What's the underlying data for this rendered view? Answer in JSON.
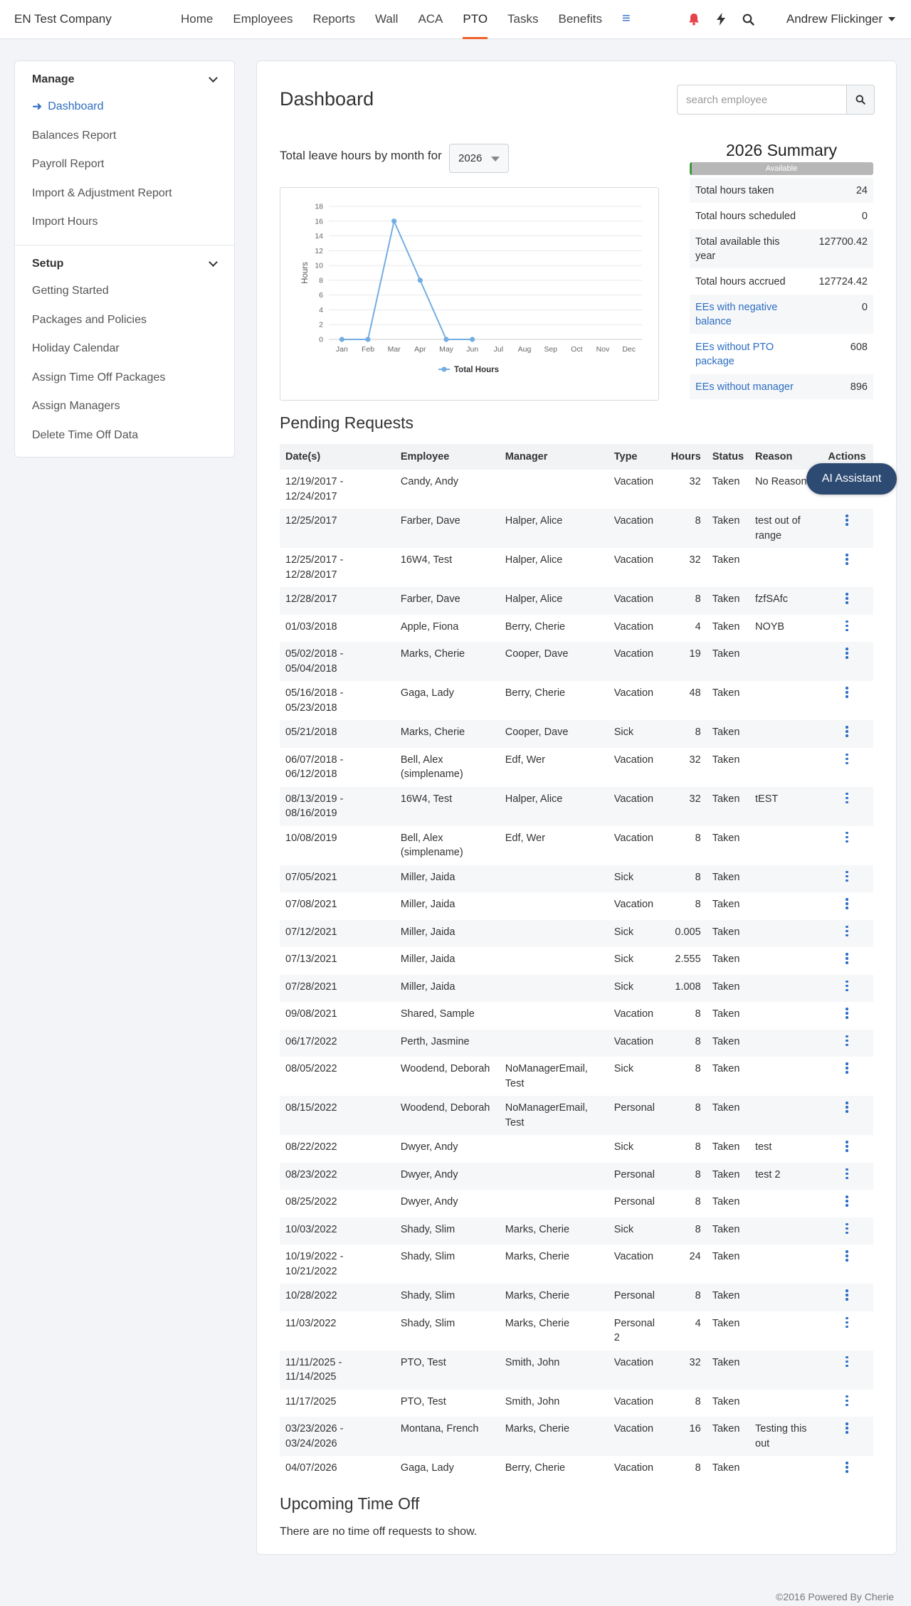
{
  "app": {
    "company": "EN Test Company",
    "nav": [
      "Home",
      "Employees",
      "Reports",
      "Wall",
      "ACA",
      "PTO",
      "Tasks",
      "Benefits"
    ],
    "active_nav": "PTO",
    "menu_icon": "hamburger-icon",
    "icons": [
      "bell-icon",
      "lightning-icon",
      "search-icon"
    ],
    "user": "Andrew Flickinger",
    "accent_color": "#f0622d",
    "link_color": "#2c6dc2"
  },
  "sidebar": {
    "manage_label": "Manage",
    "manage_items": [
      "Dashboard",
      "Balances Report",
      "Payroll Report",
      "Import & Adjustment Report",
      "Import Hours"
    ],
    "setup_label": "Setup",
    "setup_items": [
      "Getting Started",
      "Packages and Policies",
      "Holiday Calendar",
      "Assign Time Off Packages",
      "Assign Managers",
      "Delete Time Off Data"
    ]
  },
  "main": {
    "title": "Dashboard",
    "search_placeholder": "search employee",
    "leave_label": "Total leave hours by month for",
    "year": "2026"
  },
  "chart_data": {
    "type": "line",
    "categories": [
      "Jan",
      "Feb",
      "Mar",
      "Apr",
      "May",
      "Jun",
      "Jul",
      "Aug",
      "Sep",
      "Oct",
      "Nov",
      "Dec"
    ],
    "series": [
      {
        "name": "Total Hours",
        "values": [
          0,
          0,
          16,
          8,
          0,
          0,
          null,
          null,
          null,
          null,
          null,
          null
        ]
      }
    ],
    "ylabel": "Hours",
    "yticks": [
      0,
      2,
      4,
      6,
      8,
      10,
      12,
      14,
      16,
      18
    ],
    "ylim": [
      0,
      18
    ],
    "grid": true,
    "legend": "bottom",
    "color": "#74ade2"
  },
  "summary": {
    "title": "2026 Summary",
    "bar_label": "Available",
    "bar_fill_fraction": 0.01,
    "rows": [
      {
        "label": "Total hours taken",
        "value": "24",
        "link": false
      },
      {
        "label": "Total hours scheduled",
        "value": "0",
        "link": false
      },
      {
        "label": "Total available this year",
        "value": "127700.42",
        "link": false
      },
      {
        "label": "Total hours accrued",
        "value": "127724.42",
        "link": false
      },
      {
        "label": "EEs with negative balance",
        "value": "0",
        "link": true
      },
      {
        "label": "EEs without PTO package",
        "value": "608",
        "link": true
      },
      {
        "label": "EEs without manager",
        "value": "896",
        "link": true
      }
    ]
  },
  "pending": {
    "title": "Pending Requests",
    "columns": [
      "Date(s)",
      "Employee",
      "Manager",
      "Type",
      "Hours",
      "Status",
      "Reason",
      "Actions"
    ],
    "rows": [
      [
        "12/19/2017 - 12/24/2017",
        "Candy, Andy",
        "",
        "Vacation",
        "32",
        "Taken",
        "No Reason"
      ],
      [
        "12/25/2017",
        "Farber, Dave",
        "Halper, Alice",
        "Vacation",
        "8",
        "Taken",
        "test out of range"
      ],
      [
        "12/25/2017 - 12/28/2017",
        "16W4, Test",
        "Halper, Alice",
        "Vacation",
        "32",
        "Taken",
        ""
      ],
      [
        "12/28/2017",
        "Farber, Dave",
        "Halper, Alice",
        "Vacation",
        "8",
        "Taken",
        "fzfSAfc"
      ],
      [
        "01/03/2018",
        "Apple, Fiona",
        "Berry, Cherie",
        "Vacation",
        "4",
        "Taken",
        "NOYB"
      ],
      [
        "05/02/2018 - 05/04/2018",
        "Marks, Cherie",
        "Cooper, Dave",
        "Vacation",
        "19",
        "Taken",
        ""
      ],
      [
        "05/16/2018 - 05/23/2018",
        "Gaga, Lady",
        "Berry, Cherie",
        "Vacation",
        "48",
        "Taken",
        ""
      ],
      [
        "05/21/2018",
        "Marks, Cherie",
        "Cooper, Dave",
        "Sick",
        "8",
        "Taken",
        ""
      ],
      [
        "06/07/2018 - 06/12/2018",
        "Bell, Alex (simplename)",
        "Edf, Wer",
        "Vacation",
        "32",
        "Taken",
        ""
      ],
      [
        "08/13/2019 - 08/16/2019",
        "16W4, Test",
        "Halper, Alice",
        "Vacation",
        "32",
        "Taken",
        "tEST"
      ],
      [
        "10/08/2019",
        "Bell, Alex (simplename)",
        "Edf, Wer",
        "Vacation",
        "8",
        "Taken",
        ""
      ],
      [
        "07/05/2021",
        "Miller, Jaida",
        "",
        "Sick",
        "8",
        "Taken",
        ""
      ],
      [
        "07/08/2021",
        "Miller, Jaida",
        "",
        "Vacation",
        "8",
        "Taken",
        ""
      ],
      [
        "07/12/2021",
        "Miller, Jaida",
        "",
        "Sick",
        "0.005",
        "Taken",
        ""
      ],
      [
        "07/13/2021",
        "Miller, Jaida",
        "",
        "Sick",
        "2.555",
        "Taken",
        ""
      ],
      [
        "07/28/2021",
        "Miller, Jaida",
        "",
        "Sick",
        "1.008",
        "Taken",
        ""
      ],
      [
        "09/08/2021",
        "Shared, Sample",
        "",
        "Vacation",
        "8",
        "Taken",
        ""
      ],
      [
        "06/17/2022",
        "Perth, Jasmine",
        "",
        "Vacation",
        "8",
        "Taken",
        ""
      ],
      [
        "08/05/2022",
        "Woodend, Deborah",
        "NoManagerEmail, Test",
        "Sick",
        "8",
        "Taken",
        ""
      ],
      [
        "08/15/2022",
        "Woodend, Deborah",
        "NoManagerEmail, Test",
        "Personal",
        "8",
        "Taken",
        ""
      ],
      [
        "08/22/2022",
        "Dwyer, Andy",
        "",
        "Sick",
        "8",
        "Taken",
        "test"
      ],
      [
        "08/23/2022",
        "Dwyer, Andy",
        "",
        "Personal",
        "8",
        "Taken",
        "test 2"
      ],
      [
        "08/25/2022",
        "Dwyer, Andy",
        "",
        "Personal",
        "8",
        "Taken",
        ""
      ],
      [
        "10/03/2022",
        "Shady, Slim",
        "Marks, Cherie",
        "Sick",
        "8",
        "Taken",
        ""
      ],
      [
        "10/19/2022 - 10/21/2022",
        "Shady, Slim",
        "Marks, Cherie",
        "Vacation",
        "24",
        "Taken",
        ""
      ],
      [
        "10/28/2022",
        "Shady, Slim",
        "Marks, Cherie",
        "Personal",
        "8",
        "Taken",
        ""
      ],
      [
        "11/03/2022",
        "Shady, Slim",
        "Marks, Cherie",
        "Personal 2",
        "4",
        "Taken",
        ""
      ],
      [
        "11/11/2025 - 11/14/2025",
        "PTO, Test",
        "Smith, John",
        "Vacation",
        "32",
        "Taken",
        ""
      ],
      [
        "11/17/2025",
        "PTO, Test",
        "Smith, John",
        "Vacation",
        "8",
        "Taken",
        ""
      ],
      [
        "03/23/2026 - 03/24/2026",
        "Montana, French",
        "Marks, Cherie",
        "Vacation",
        "16",
        "Taken",
        "Testing this out"
      ],
      [
        "04/07/2026",
        "Gaga, Lady",
        "Berry, Cherie",
        "Vacation",
        "8",
        "Taken",
        ""
      ]
    ]
  },
  "upcoming": {
    "title": "Upcoming Time Off",
    "empty_text": "There are no time off requests to show."
  },
  "ai_assistant": "AI Assistant",
  "footer": "©2016 Powered By Cherie"
}
